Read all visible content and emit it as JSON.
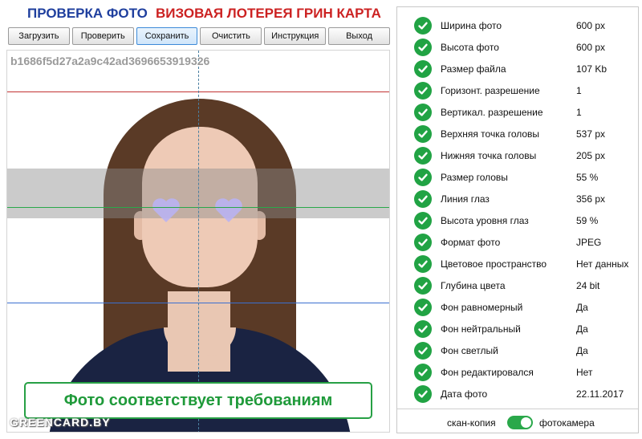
{
  "header": {
    "title_left": "ПРОВЕРКА ФОТО",
    "title_right": "ВИЗОВАЯ ЛОТЕРЕЯ ГРИН КАРТА"
  },
  "toolbar": {
    "buttons": [
      "Загрузить",
      "Проверить",
      "Сохранить",
      "Очистить",
      "Инструкция",
      "Выход"
    ],
    "active": "Сохранить"
  },
  "photo": {
    "hash": "b1686f5d27a2a9c42ad3696653919326",
    "status": "Фото соответствует требованиям",
    "watermark": "GREENCARD.BY"
  },
  "checks": [
    {
      "label": "Ширина фото",
      "value": "600 px"
    },
    {
      "label": "Высота фото",
      "value": "600 px"
    },
    {
      "label": "Размер файла",
      "value": "107 Kb"
    },
    {
      "label": "Горизонт. разрешение",
      "value": "1"
    },
    {
      "label": "Вертикал. разрешение",
      "value": "1"
    },
    {
      "label": "Верхняя точка головы",
      "value": "537 px"
    },
    {
      "label": "Нижняя точка головы",
      "value": "205 px"
    },
    {
      "label": "Размер головы",
      "value": "55 %"
    },
    {
      "label": "Линия глаз",
      "value": "356 px"
    },
    {
      "label": "Высота уровня глаз",
      "value": "59 %"
    },
    {
      "label": "Формат фото",
      "value": "JPEG"
    },
    {
      "label": "Цветовое пространство",
      "value": "Нет данных"
    },
    {
      "label": "Глубина цвета",
      "value": "24 bit"
    },
    {
      "label": "Фон равномерный",
      "value": "Да"
    },
    {
      "label": "Фон нейтральный",
      "value": "Да"
    },
    {
      "label": "Фон светлый",
      "value": "Да"
    },
    {
      "label": "Фон редактировался",
      "value": "Нет"
    },
    {
      "label": "Дата фото",
      "value": "22.11.2017"
    }
  ],
  "mode": {
    "left_label": "скан-копия",
    "right_label": "фотокамера",
    "toggle_on": true
  },
  "colors": {
    "title_blue": "#1f3f9e",
    "title_red": "#cc2222",
    "check_green": "#21a344"
  }
}
